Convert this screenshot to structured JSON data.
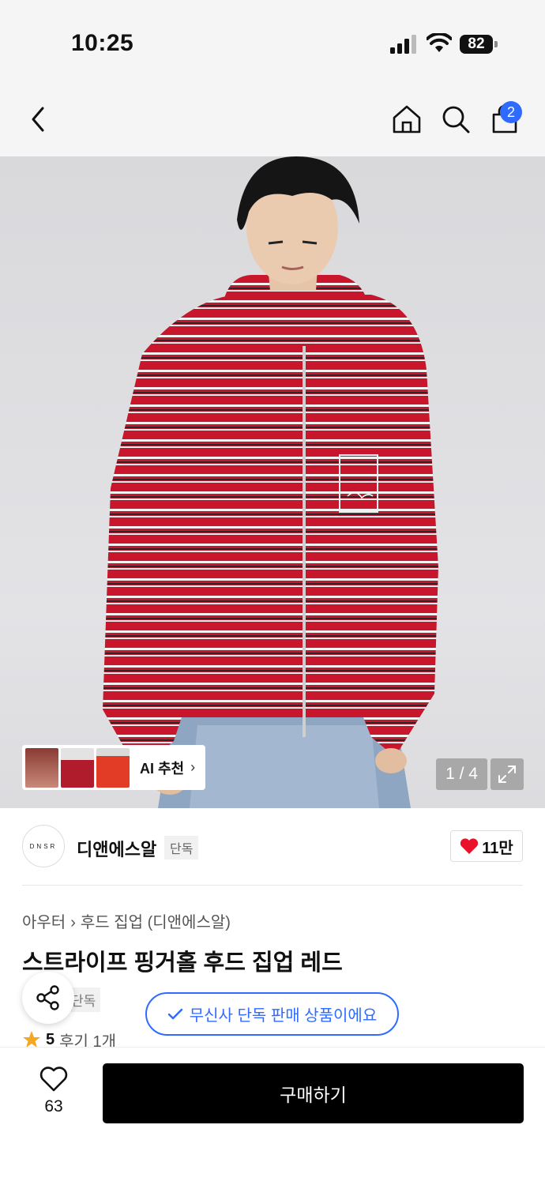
{
  "status": {
    "time": "10:25",
    "battery": "82"
  },
  "nav": {
    "cart_count": "2"
  },
  "gallery": {
    "ai_label": "AI 추천",
    "counter": "1 / 4"
  },
  "brand": {
    "logo_text": "DNSR",
    "name": "디앤에스알",
    "tag": "단독",
    "likes": "11만"
  },
  "breadcrumb": {
    "category": "아우터",
    "sub": "후드 집업 (디앤에스알)"
  },
  "product": {
    "title": "스트라이프 핑거홀 후드 집업 레드",
    "tag": "단독",
    "musinsa_notice": "무신사 단독 판매 상품이에요",
    "rating": "5",
    "reviews": "후기 1개"
  },
  "bottom": {
    "wish_count": "63",
    "buy_label": "구매하기"
  },
  "colors": {
    "accent": "#2f6bff",
    "heart": "#e8132b",
    "star": "#f5a623",
    "hoodie": "#c8162c"
  }
}
